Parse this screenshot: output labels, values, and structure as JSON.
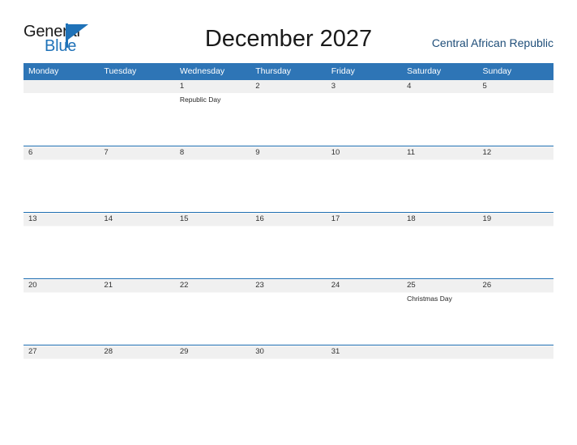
{
  "brand": {
    "name_part1": "General",
    "name_part2": "Blue",
    "mark_icon": "triangle-flag-icon",
    "color_primary": "#1f72b8",
    "color_text": "#1a1a1a"
  },
  "header": {
    "title": "December 2027",
    "country": "Central African Republic"
  },
  "calendar": {
    "header_bg": "#2e75b6",
    "row_rule_color": "#1f6fb2",
    "daynum_band_color": "#f0f0f0",
    "weekday_headers": [
      "Monday",
      "Tuesday",
      "Wednesday",
      "Thursday",
      "Friday",
      "Saturday",
      "Sunday"
    ],
    "weeks": [
      [
        {
          "day": "",
          "event": ""
        },
        {
          "day": "",
          "event": ""
        },
        {
          "day": "1",
          "event": "Republic Day"
        },
        {
          "day": "2",
          "event": ""
        },
        {
          "day": "3",
          "event": ""
        },
        {
          "day": "4",
          "event": ""
        },
        {
          "day": "5",
          "event": ""
        }
      ],
      [
        {
          "day": "6",
          "event": ""
        },
        {
          "day": "7",
          "event": ""
        },
        {
          "day": "8",
          "event": ""
        },
        {
          "day": "9",
          "event": ""
        },
        {
          "day": "10",
          "event": ""
        },
        {
          "day": "11",
          "event": ""
        },
        {
          "day": "12",
          "event": ""
        }
      ],
      [
        {
          "day": "13",
          "event": ""
        },
        {
          "day": "14",
          "event": ""
        },
        {
          "day": "15",
          "event": ""
        },
        {
          "day": "16",
          "event": ""
        },
        {
          "day": "17",
          "event": ""
        },
        {
          "day": "18",
          "event": ""
        },
        {
          "day": "19",
          "event": ""
        }
      ],
      [
        {
          "day": "20",
          "event": ""
        },
        {
          "day": "21",
          "event": ""
        },
        {
          "day": "22",
          "event": ""
        },
        {
          "day": "23",
          "event": ""
        },
        {
          "day": "24",
          "event": ""
        },
        {
          "day": "25",
          "event": "Christmas Day"
        },
        {
          "day": "26",
          "event": ""
        }
      ],
      [
        {
          "day": "27",
          "event": ""
        },
        {
          "day": "28",
          "event": ""
        },
        {
          "day": "29",
          "event": ""
        },
        {
          "day": "30",
          "event": ""
        },
        {
          "day": "31",
          "event": ""
        },
        {
          "day": "",
          "event": ""
        },
        {
          "day": "",
          "event": ""
        }
      ]
    ]
  }
}
